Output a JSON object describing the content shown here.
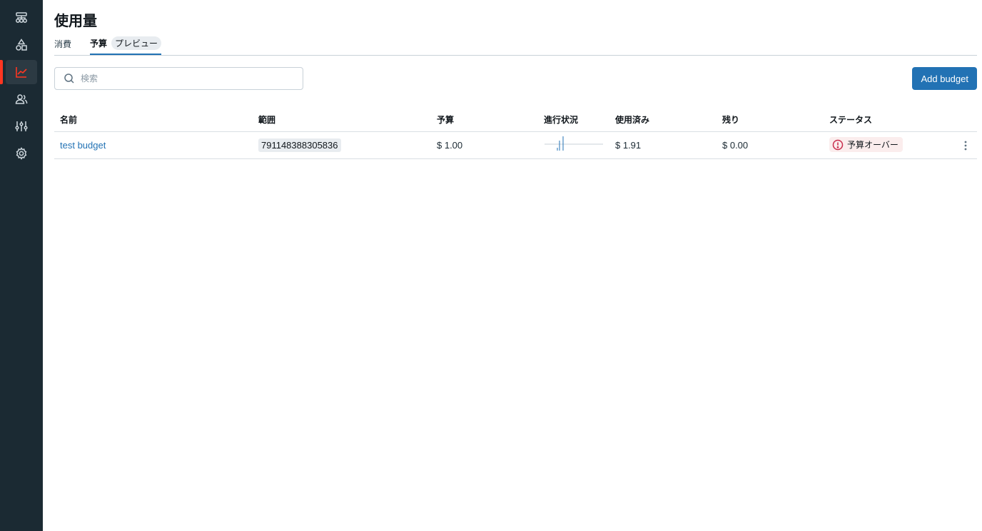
{
  "page": {
    "title": "使用量"
  },
  "tabs": [
    {
      "label": "消費"
    },
    {
      "label": "予算",
      "badge": "プレビュー"
    }
  ],
  "search": {
    "placeholder": "検索",
    "icon": "search-icon"
  },
  "actions": {
    "add_budget": "Add budget"
  },
  "sidebar": {
    "items": [
      {
        "icon": "catalog-icon"
      },
      {
        "icon": "shapes-icon"
      },
      {
        "icon": "chart-line-icon",
        "active": true
      },
      {
        "icon": "users-icon"
      },
      {
        "icon": "sliders-icon"
      },
      {
        "icon": "gear-icon"
      }
    ],
    "active_accent": "#ff3621"
  },
  "table": {
    "columns": {
      "name": "名前",
      "scope": "範囲",
      "budget": "予算",
      "progress": "進行状況",
      "used": "使用済み",
      "remaining": "残り",
      "status": "ステータス"
    },
    "rows": [
      {
        "name": "test budget",
        "scope": "791148388305836",
        "budget": "$ 1.00",
        "progress_ratio": 1.91,
        "used": "$ 1.91",
        "remaining": "$ 0.00",
        "status": "予算オーバー",
        "status_icon": "alert-circle-icon"
      }
    ]
  },
  "colors": {
    "primary": "#2272b4",
    "danger": "#c82d4c",
    "sidebar_bg": "#1b2a33"
  }
}
